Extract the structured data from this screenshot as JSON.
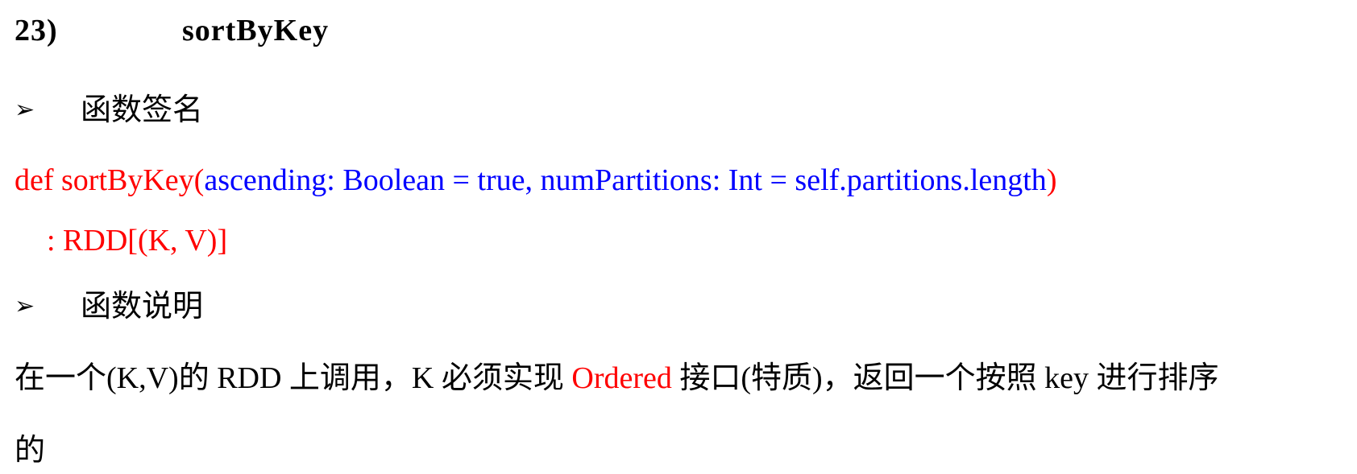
{
  "heading": {
    "number": "23)",
    "title": "sortByKey"
  },
  "section_signature": {
    "marker": "➢",
    "label": "函数签名"
  },
  "signature": {
    "def_part": "def sortByKey(",
    "params": "ascending: Boolean = true, numPartitions: Int = self.partitions.length",
    "close_paren": ")",
    "return_type": ": RDD[(K, V)]"
  },
  "section_description": {
    "marker": "➢",
    "label": "函数说明"
  },
  "description": {
    "before": "在一个(K,V)的 RDD 上调用，K 必须实现 ",
    "highlight": "Ordered",
    "after": " 接口(特质)，返回一个按照 key 进行排序",
    "continuation": "的"
  },
  "colors": {
    "code_keyword": "#ff0000",
    "code_params": "#0000ff",
    "text": "#000000"
  }
}
